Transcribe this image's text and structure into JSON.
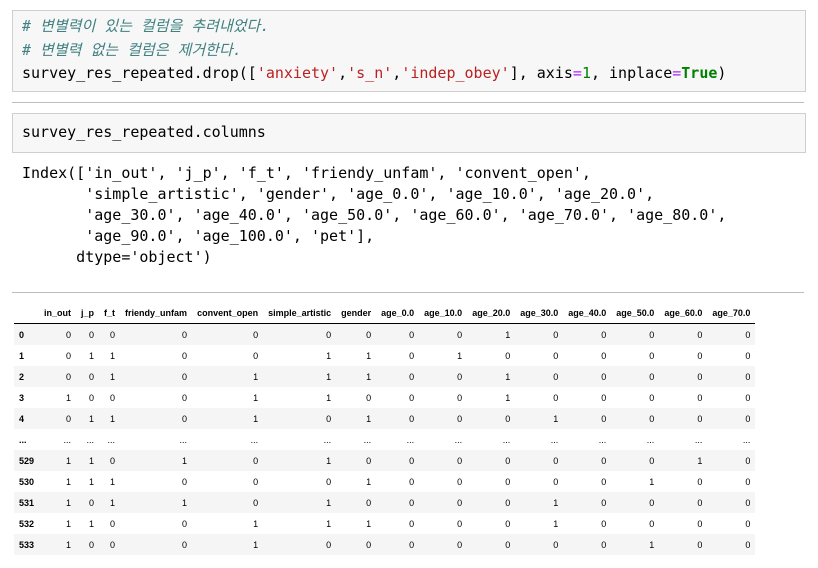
{
  "cell1": {
    "comment1": "# 변별력이 있는 컬럼을 추려내었다.",
    "comment2": "# 변별력 없는 컬럼은 제거한다.",
    "code_pre": "survey_res_repeated.drop([",
    "str1": "'anxiety'",
    "comma": ",",
    "str2": "'s_n'",
    "str3": "'indep_obey'",
    "code_mid": "], axis",
    "eq": "=",
    "one": "1",
    "code_mid2": ", inplace",
    "kw_true": "True",
    "code_end": ")"
  },
  "cell2": {
    "code": "survey_res_repeated.columns"
  },
  "output2": {
    "lines": [
      "Index(['in_out', 'j_p', 'f_t', 'friendy_unfam', 'convent_open',",
      "       'simple_artistic', 'gender', 'age_0.0', 'age_10.0', 'age_20.0',",
      "       'age_30.0', 'age_40.0', 'age_50.0', 'age_60.0', 'age_70.0', 'age_80.0',",
      "       'age_90.0', 'age_100.0', 'pet'],",
      "      dtype='object')"
    ]
  },
  "dataframe": {
    "columns": [
      "",
      "in_out",
      "j_p",
      "f_t",
      "friendy_unfam",
      "convent_open",
      "simple_artistic",
      "gender",
      "age_0.0",
      "age_10.0",
      "age_20.0",
      "age_30.0",
      "age_40.0",
      "age_50.0",
      "age_60.0",
      "age_70.0"
    ],
    "rows": [
      [
        "0",
        "0",
        "0",
        "0",
        "0",
        "0",
        "0",
        "0",
        "0",
        "0",
        "1",
        "0",
        "0",
        "0",
        "0",
        "0"
      ],
      [
        "1",
        "0",
        "1",
        "1",
        "0",
        "0",
        "1",
        "1",
        "0",
        "1",
        "0",
        "0",
        "0",
        "0",
        "0",
        "0"
      ],
      [
        "2",
        "0",
        "0",
        "1",
        "0",
        "1",
        "1",
        "1",
        "0",
        "0",
        "1",
        "0",
        "0",
        "0",
        "0",
        "0"
      ],
      [
        "3",
        "1",
        "0",
        "0",
        "0",
        "1",
        "1",
        "0",
        "0",
        "0",
        "1",
        "0",
        "0",
        "0",
        "0",
        "0"
      ],
      [
        "4",
        "0",
        "1",
        "1",
        "0",
        "1",
        "0",
        "1",
        "0",
        "0",
        "0",
        "1",
        "0",
        "0",
        "0",
        "0"
      ],
      [
        "...",
        "...",
        "...",
        "...",
        "...",
        "...",
        "...",
        "...",
        "...",
        "...",
        "...",
        "...",
        "...",
        "...",
        "...",
        "..."
      ],
      [
        "529",
        "1",
        "1",
        "0",
        "1",
        "0",
        "1",
        "0",
        "0",
        "0",
        "0",
        "0",
        "0",
        "0",
        "1",
        "0"
      ],
      [
        "530",
        "1",
        "1",
        "1",
        "0",
        "0",
        "0",
        "1",
        "0",
        "0",
        "0",
        "0",
        "0",
        "1",
        "0",
        "0"
      ],
      [
        "531",
        "1",
        "0",
        "1",
        "1",
        "0",
        "1",
        "0",
        "0",
        "0",
        "0",
        "1",
        "0",
        "0",
        "0",
        "0"
      ],
      [
        "532",
        "1",
        "1",
        "0",
        "0",
        "1",
        "1",
        "1",
        "0",
        "0",
        "0",
        "1",
        "0",
        "0",
        "0",
        "0"
      ],
      [
        "533",
        "1",
        "0",
        "0",
        "0",
        "1",
        "0",
        "0",
        "0",
        "0",
        "0",
        "0",
        "0",
        "1",
        "0",
        "0"
      ]
    ]
  }
}
